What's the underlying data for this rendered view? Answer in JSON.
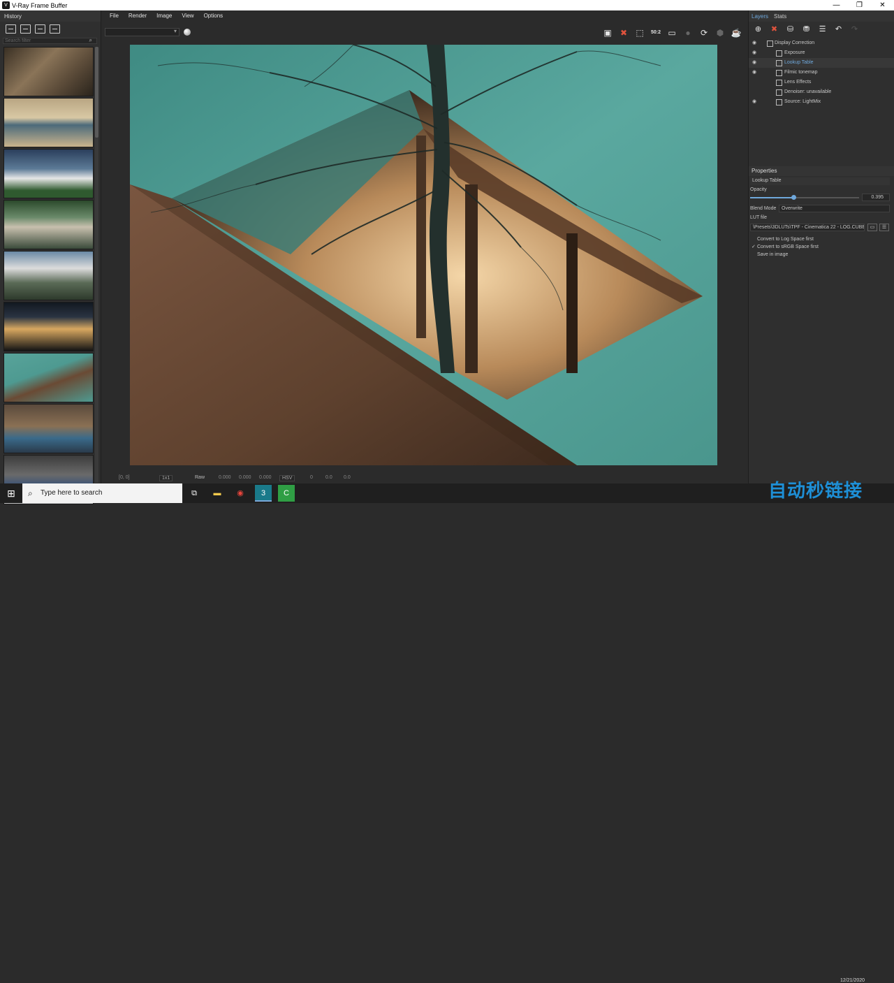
{
  "window": {
    "title": "V-Ray Frame Buffer",
    "minimize": "—",
    "restore": "❐",
    "close": "✕"
  },
  "menu": [
    "File",
    "Render",
    "Image",
    "View",
    "Options"
  ],
  "history": {
    "title": "History",
    "search_placeholder": "Search filter"
  },
  "right_tabs": {
    "layers": "Layers",
    "stats": "Stats"
  },
  "layers": [
    {
      "name": "Display Correction",
      "visible": true
    },
    {
      "name": "Exposure",
      "visible": true
    },
    {
      "name": "Lookup Table",
      "visible": true,
      "selected": true
    },
    {
      "name": "Filmic tonemap",
      "visible": true
    },
    {
      "name": "Lens Effects",
      "visible": false
    },
    {
      "name": "Denoiser: unavailable",
      "visible": false
    },
    {
      "name": "Source: LightMix",
      "visible": true
    }
  ],
  "properties": {
    "header": "Properties",
    "layer_name": "Lookup Table",
    "opacity_label": "Opacity",
    "opacity_value": "0.395",
    "opacity_fraction": 0.395,
    "blend_mode_label": "Blend Mode",
    "blend_mode_value": "Overwrite",
    "lut_file_label": "LUT file",
    "lut_file_value": "\\Presets\\3DLUTs\\TPF - Cinematica 22 - LOG.CUBE",
    "checkboxes": [
      {
        "label": "Convert to Log Space first",
        "checked": false
      },
      {
        "label": "Convert to sRGB Space first",
        "checked": true
      },
      {
        "label": "Save in image",
        "checked": false
      }
    ]
  },
  "toolbar": {
    "zoom_box": "50:2"
  },
  "status": {
    "coords": "[0, 0]",
    "ratio": "1x1",
    "raw_label": "Raw",
    "r": "0.000",
    "g": "0.000",
    "b": "0.000",
    "mode": "HSV",
    "h": "0",
    "s": "0.0",
    "v": "0.0"
  },
  "taskbar": {
    "search_placeholder": "Type here to search",
    "date": "12/21/2020"
  },
  "watermark": "自动秒链接",
  "colors": {
    "accent": "#6fa8dc",
    "teal": "#4e9a91",
    "wood": "#6a4a34",
    "stop_red": "#e0533d"
  }
}
